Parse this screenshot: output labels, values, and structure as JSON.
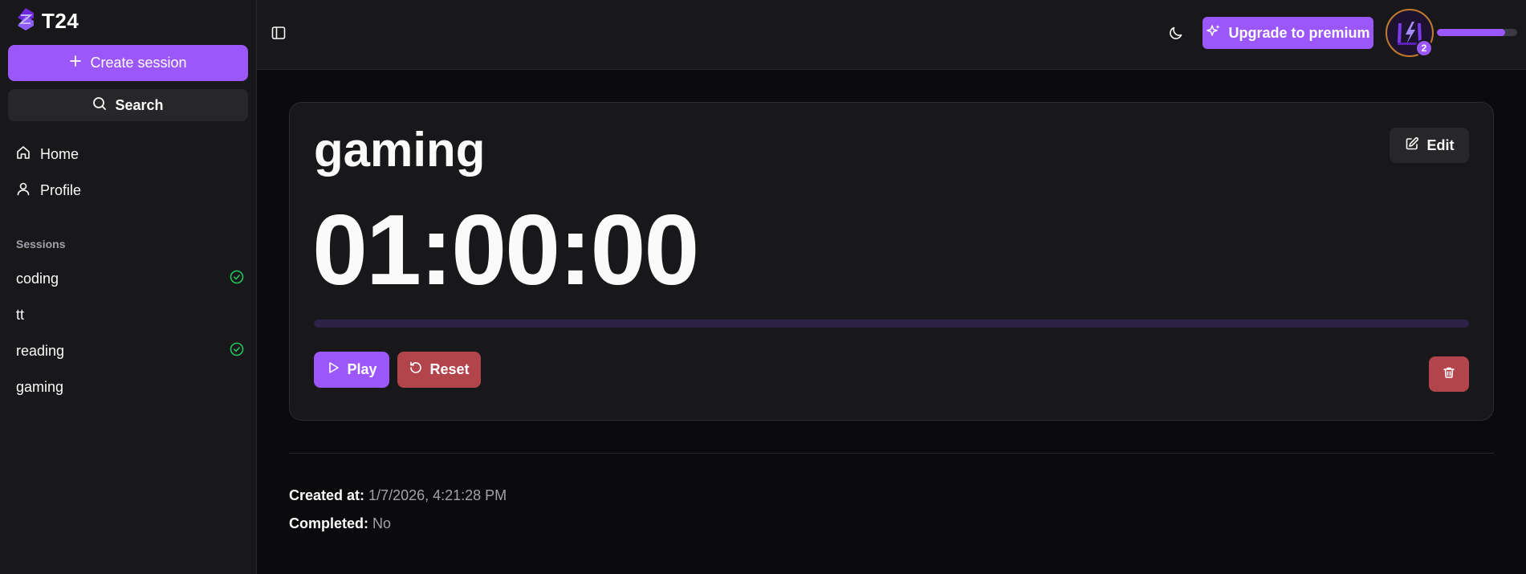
{
  "app": {
    "name": "T24"
  },
  "sidebar": {
    "create_label": "Create session",
    "search_label": "Search",
    "nav": [
      {
        "label": "Home",
        "icon": "home-icon"
      },
      {
        "label": "Profile",
        "icon": "user-icon"
      }
    ],
    "sessions_heading": "Sessions",
    "sessions": [
      {
        "label": "coding",
        "completed": true
      },
      {
        "label": "tt",
        "completed": false
      },
      {
        "label": "reading",
        "completed": true
      },
      {
        "label": "gaming",
        "completed": false
      }
    ]
  },
  "topbar": {
    "upgrade_label": "Upgrade to premium",
    "level": "2",
    "xp_progress": 0.85
  },
  "session": {
    "title": "gaming",
    "edit_label": "Edit",
    "timer": "01:00:00",
    "progress": 0,
    "play_label": "Play",
    "reset_label": "Reset",
    "created_label": "Created at:",
    "created_value": "1/7/2026, 4:21:28 PM",
    "completed_label": "Completed:",
    "completed_value": "No"
  },
  "colors": {
    "accent": "#9b57f9",
    "danger": "#b2444c",
    "success": "#22c55e",
    "background": "#0b0b0d",
    "surface": "#18181b"
  }
}
